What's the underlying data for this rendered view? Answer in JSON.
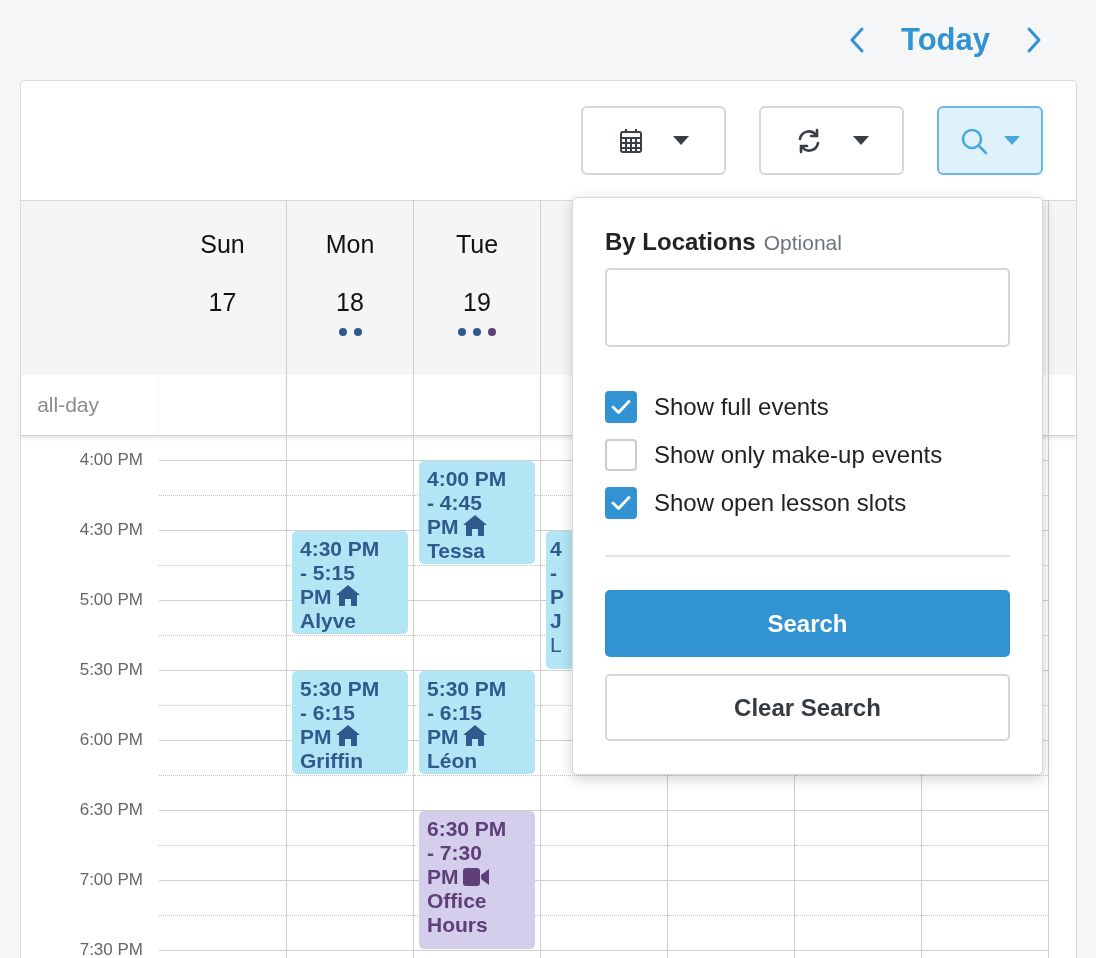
{
  "nav": {
    "today": "Today"
  },
  "toolbar": {
    "buttons": [
      {
        "kind": "calendar",
        "selected": false
      },
      {
        "kind": "refresh",
        "selected": false
      },
      {
        "kind": "search",
        "selected": true
      }
    ]
  },
  "calendar": {
    "all_day_label": "all-day",
    "days": [
      {
        "name": "Sun",
        "date": "17"
      },
      {
        "name": "Mon",
        "date": "18",
        "dots": [
          {
            "color": "#2f5a8e"
          },
          {
            "color": "#2f5a8e"
          }
        ],
        "events": [
          {
            "kind": "lesson",
            "time": "4:30 PM - 5:15 PM",
            "name": "Alyve"
          },
          {
            "kind": "lesson",
            "time": "5:30 PM - 6:15 PM",
            "name": "Griffin"
          }
        ]
      },
      {
        "name": "Tue",
        "date": "19",
        "dots": [
          {
            "color": "#2f5a8e"
          },
          {
            "color": "#2f5a8e"
          },
          {
            "color": "#5e3f78"
          }
        ],
        "events": [
          {
            "kind": "lesson",
            "time": "4:00 PM - 4:45 PM",
            "name": "Tessa"
          },
          {
            "kind": "lesson",
            "time": "5:30 PM - 6:15 PM",
            "name": "Léon"
          },
          {
            "kind": "office",
            "time": "6:30 PM - 7:30 PM",
            "name": "Office Hours"
          }
        ]
      },
      {
        "events": [
          {
            "kind": "clipped",
            "time": "4 - P",
            "name": "J",
            "location": "L"
          }
        ]
      }
    ],
    "time_labels": [
      "4:00 PM",
      "4:30 PM",
      "5:00 PM",
      "5:30 PM",
      "6:00 PM",
      "6:30 PM",
      "7:00 PM",
      "7:30 PM"
    ]
  },
  "search_popup": {
    "title": "By Locations",
    "optional": "Optional",
    "options": [
      {
        "label": "Show full events",
        "checked": true
      },
      {
        "label": "Show only make-up events",
        "checked": false
      },
      {
        "label": "Show open lesson slots",
        "checked": true
      }
    ],
    "search_button": "Search",
    "clear_button": "Clear Search"
  }
}
